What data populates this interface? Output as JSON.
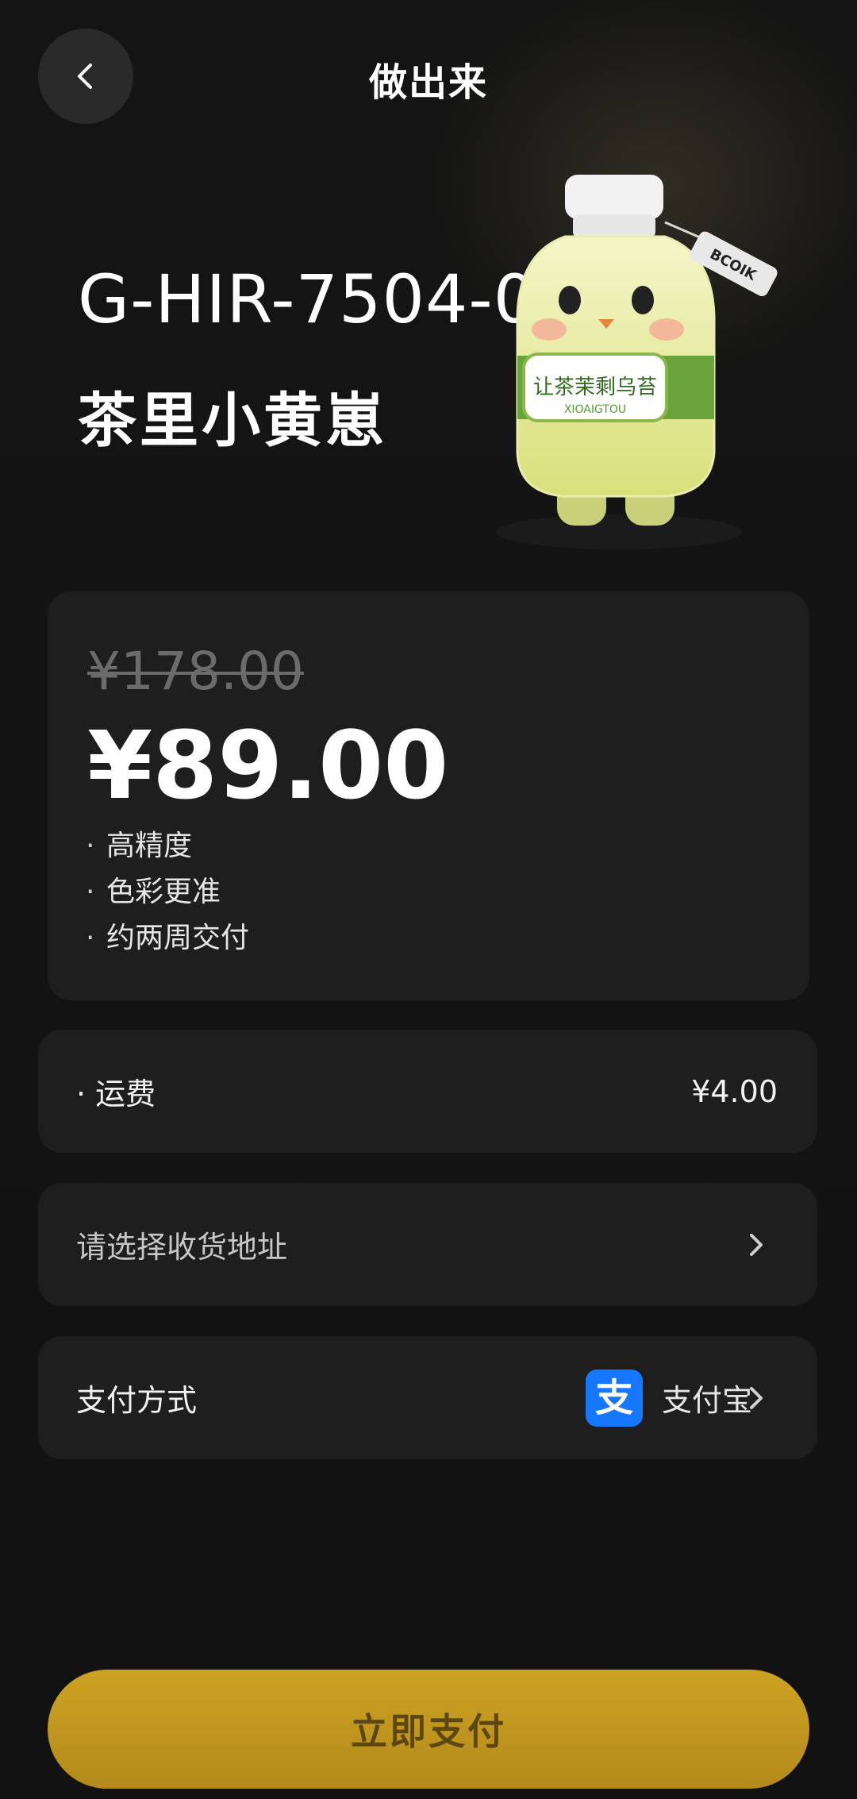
{
  "header": {
    "title": "做出来"
  },
  "product": {
    "code": "G-HIR-7504-0",
    "name": "茶里小黄崽",
    "mascot_label": "让茶茉剩乌苔",
    "mascot_sub": "XIOAIGTOU",
    "mascot_tag": "BCOIK"
  },
  "pricing": {
    "original_price": "¥178.00",
    "current_price": "¥89.00",
    "features": [
      "高精度",
      "色彩更准",
      "约两周交付"
    ],
    "bullet": "·"
  },
  "shipping": {
    "label": "· 运费",
    "value": "¥4.00"
  },
  "address": {
    "placeholder": "请选择收货地址"
  },
  "payment": {
    "label": "支付方式",
    "method": "支付宝",
    "icon": "alipay-icon",
    "icon_char": "支",
    "icon_color": "#1677ff"
  },
  "actions": {
    "pay_now": "立即支付",
    "accent": "#cda222"
  }
}
